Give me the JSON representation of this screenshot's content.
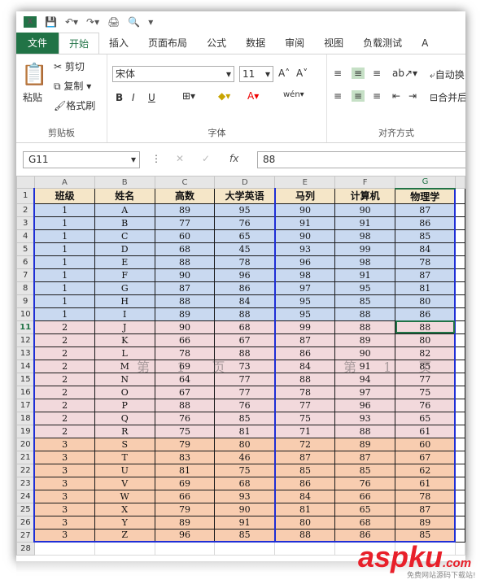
{
  "qat": {
    "app_icon": "X",
    "save_icon": "save-icon",
    "undo_icon": "undo-icon",
    "redo_icon": "redo-icon",
    "dropdown": "▾"
  },
  "tabs": [
    "文件",
    "开始",
    "插入",
    "页面布局",
    "公式",
    "数据",
    "审阅",
    "视图",
    "负载测试",
    "A"
  ],
  "ribbon": {
    "paste": "粘贴",
    "cut": "剪切",
    "copy": "复制",
    "format_painter": "格式刷",
    "clipboard_label": "剪贴板",
    "font_name": "宋体",
    "font_size": "11",
    "bold": "B",
    "italic": "I",
    "underline": "U",
    "font_label": "字体",
    "wrap": "自动换",
    "merge": "合并后",
    "align_label": "对齐方式"
  },
  "formula_bar": {
    "name_box": "G11",
    "fx": "fx",
    "value": "88"
  },
  "watermarks": {
    "left": "第 1 页",
    "right": "第 1 页"
  },
  "columns": [
    "A",
    "B",
    "C",
    "D",
    "E",
    "F",
    "G"
  ],
  "headers": [
    "班级",
    "姓名",
    "高数",
    "大学英语",
    "马列",
    "计算机",
    "物理学"
  ],
  "rows": [
    [
      "1",
      "A",
      "89",
      "95",
      "90",
      "90",
      "87"
    ],
    [
      "1",
      "B",
      "77",
      "76",
      "91",
      "91",
      "86"
    ],
    [
      "1",
      "C",
      "60",
      "65",
      "90",
      "98",
      "85"
    ],
    [
      "1",
      "D",
      "68",
      "45",
      "93",
      "99",
      "84"
    ],
    [
      "1",
      "E",
      "88",
      "78",
      "96",
      "98",
      "78"
    ],
    [
      "1",
      "F",
      "90",
      "96",
      "98",
      "91",
      "87"
    ],
    [
      "1",
      "G",
      "87",
      "86",
      "97",
      "95",
      "81"
    ],
    [
      "1",
      "H",
      "88",
      "84",
      "95",
      "85",
      "80"
    ],
    [
      "1",
      "I",
      "89",
      "88",
      "95",
      "88",
      "86"
    ],
    [
      "2",
      "J",
      "90",
      "68",
      "99",
      "88",
      "88"
    ],
    [
      "2",
      "K",
      "66",
      "67",
      "87",
      "89",
      "80"
    ],
    [
      "2",
      "L",
      "78",
      "88",
      "86",
      "90",
      "82"
    ],
    [
      "2",
      "M",
      "69",
      "73",
      "84",
      "91",
      "85"
    ],
    [
      "2",
      "N",
      "64",
      "77",
      "88",
      "94",
      "77"
    ],
    [
      "2",
      "O",
      "67",
      "77",
      "78",
      "97",
      "75"
    ],
    [
      "2",
      "P",
      "88",
      "76",
      "77",
      "96",
      "76"
    ],
    [
      "2",
      "Q",
      "76",
      "85",
      "75",
      "93",
      "65"
    ],
    [
      "2",
      "R",
      "75",
      "81",
      "71",
      "88",
      "61"
    ],
    [
      "3",
      "S",
      "79",
      "80",
      "72",
      "89",
      "60"
    ],
    [
      "3",
      "T",
      "83",
      "46",
      "87",
      "87",
      "67"
    ],
    [
      "3",
      "U",
      "81",
      "75",
      "85",
      "85",
      "62"
    ],
    [
      "3",
      "V",
      "69",
      "68",
      "86",
      "76",
      "61"
    ],
    [
      "3",
      "W",
      "66",
      "93",
      "84",
      "66",
      "78"
    ],
    [
      "3",
      "X",
      "79",
      "90",
      "81",
      "65",
      "87"
    ],
    [
      "3",
      "Y",
      "89",
      "91",
      "80",
      "68",
      "89"
    ],
    [
      "3",
      "Z",
      "96",
      "85",
      "88",
      "86",
      "85"
    ]
  ],
  "logo": {
    "main": "aspku",
    "suffix": ".com",
    "sub": "免费网站源码下载站!"
  }
}
